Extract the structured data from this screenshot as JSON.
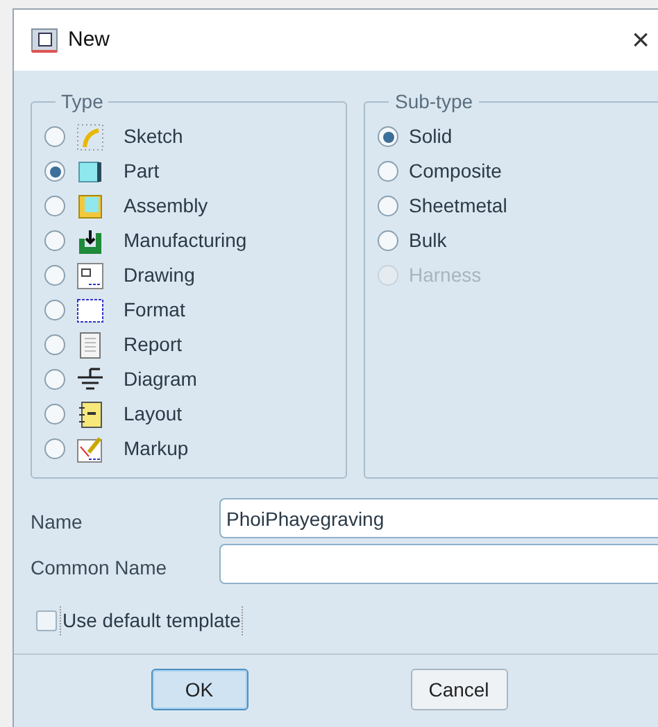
{
  "window": {
    "title": "New",
    "close": "×"
  },
  "type_group": {
    "legend": "Type",
    "items": [
      {
        "label": "Sketch",
        "kind": "sketch",
        "selected": false
      },
      {
        "label": "Part",
        "kind": "part",
        "selected": true
      },
      {
        "label": "Assembly",
        "kind": "assembly",
        "selected": false
      },
      {
        "label": "Manufacturing",
        "kind": "manufacturing",
        "selected": false
      },
      {
        "label": "Drawing",
        "kind": "drawing",
        "selected": false
      },
      {
        "label": "Format",
        "kind": "format",
        "selected": false
      },
      {
        "label": "Report",
        "kind": "report",
        "selected": false
      },
      {
        "label": "Diagram",
        "kind": "diagram",
        "selected": false
      },
      {
        "label": "Layout",
        "kind": "layout",
        "selected": false
      },
      {
        "label": "Markup",
        "kind": "markup",
        "selected": false
      }
    ]
  },
  "subtype_group": {
    "legend": "Sub-type",
    "items": [
      {
        "label": "Solid",
        "selected": true,
        "disabled": false
      },
      {
        "label": "Composite",
        "selected": false,
        "disabled": false
      },
      {
        "label": "Sheetmetal",
        "selected": false,
        "disabled": false
      },
      {
        "label": "Bulk",
        "selected": false,
        "disabled": false
      },
      {
        "label": "Harness",
        "selected": false,
        "disabled": true
      }
    ]
  },
  "fields": [
    {
      "label": "Name",
      "value": "PhoiPhayegraving"
    },
    {
      "label": "Common Name"
    }
  ],
  "use_default_template": {
    "label": "Use default template",
    "checked": false
  },
  "buttons": [
    {
      "label": "OK",
      "default": true
    },
    {
      "label": "Cancel",
      "default": false
    }
  ]
}
